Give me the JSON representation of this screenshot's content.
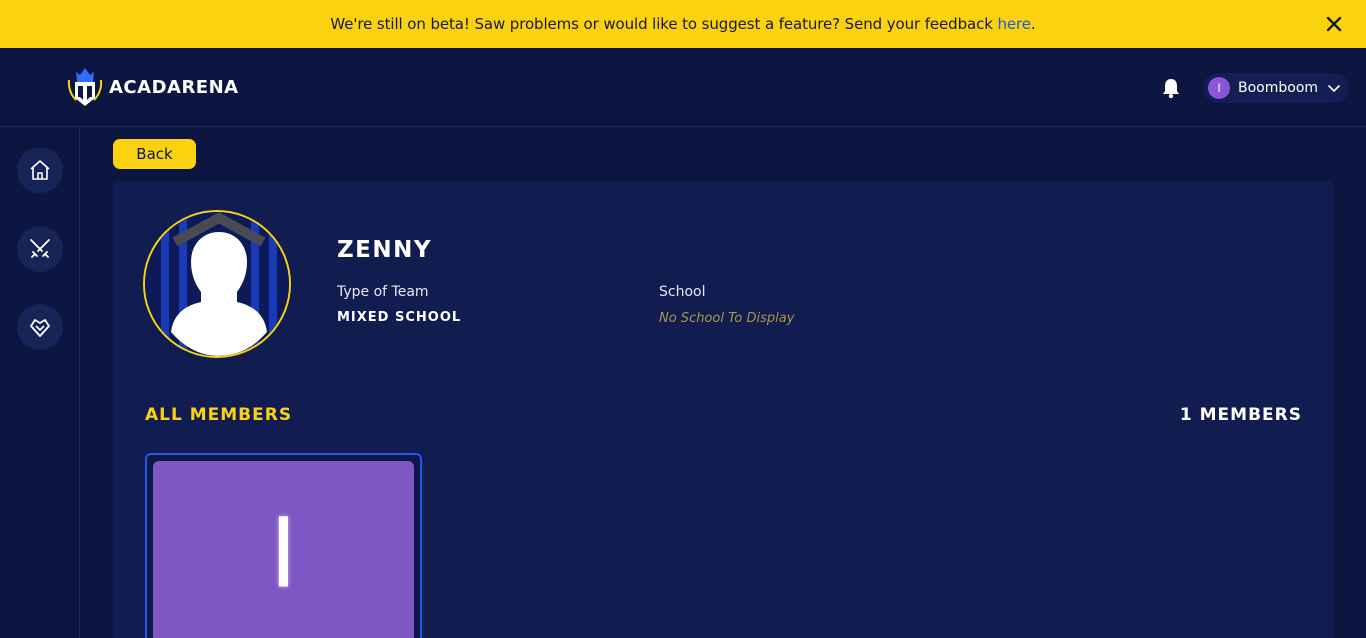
{
  "banner": {
    "text": "We're still on beta! Saw problems or would like to suggest a feature? Send your feedback ",
    "link_text": "here",
    "suffix": ".",
    "close_icon": "close-icon"
  },
  "header": {
    "brand": "ACADARENA",
    "notification_icon": "bell-icon",
    "user": {
      "initial": "I",
      "name": "Boomboom"
    }
  },
  "sidebar": {
    "items": [
      {
        "name": "home",
        "icon": "home-icon"
      },
      {
        "name": "battles",
        "icon": "crossed-swords-icon"
      },
      {
        "name": "community",
        "icon": "heart-diamond-icon"
      }
    ]
  },
  "back_label": "Back",
  "team": {
    "name": "ZENNY",
    "type_label": "Type of Team",
    "type_value": "MIXED SCHOOL",
    "school_label": "School",
    "school_value": "No School To Display"
  },
  "members": {
    "title": "ALL MEMBERS",
    "count_label": "1 MEMBERS",
    "list": [
      {
        "initial": "I"
      }
    ]
  },
  "colors": {
    "accent": "#fbd20f",
    "background": "#0c1640",
    "panel": "#111c50",
    "member_avatar": "#7f57c4",
    "link": "#1b5fd6"
  }
}
